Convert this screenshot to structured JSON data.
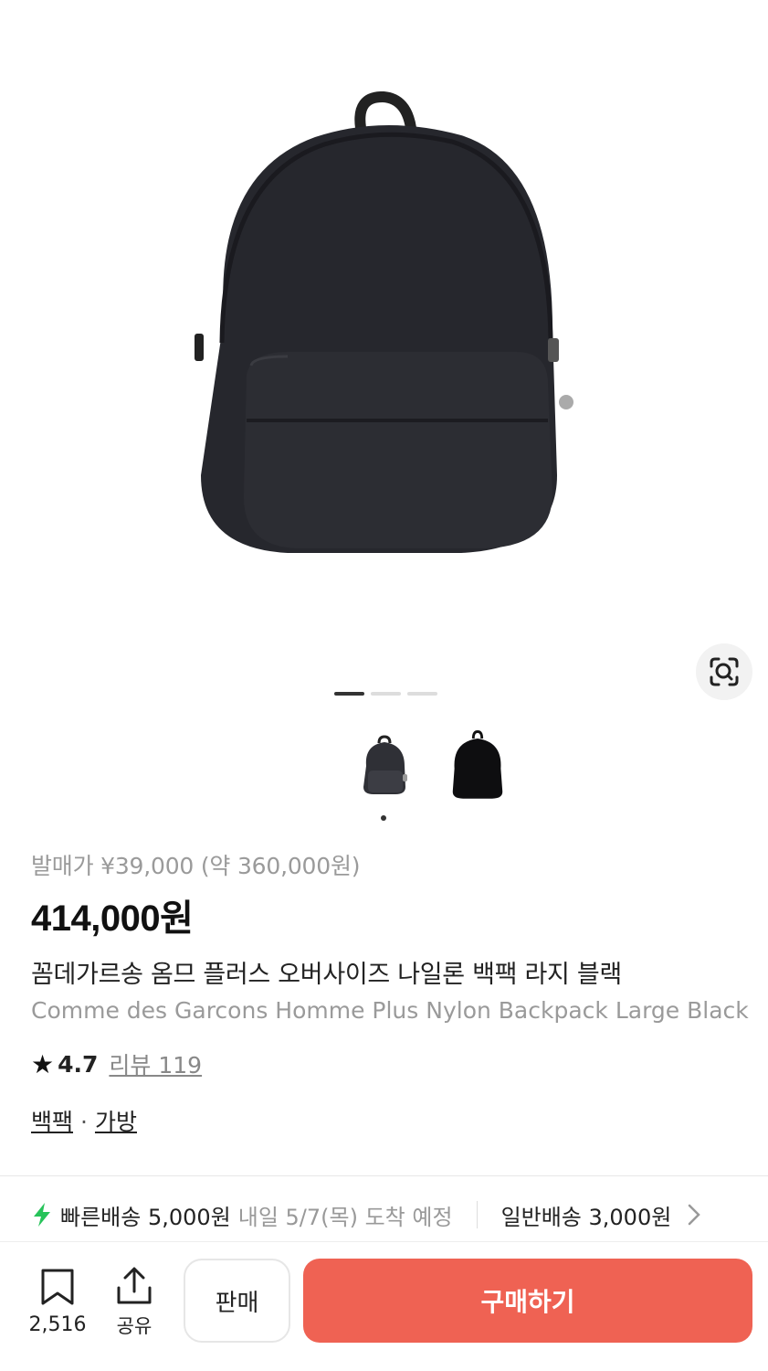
{
  "product": {
    "release_price": "발매가 ¥39,000 (약 360,000원)",
    "price": "414,000원",
    "title_ko": "꼼데가르송 옴므 플러스 오버사이즈 나일론 백팩 라지 블랙",
    "title_en": "Comme des Garcons Homme Plus Nylon Backpack Large Black",
    "rating": "4.7",
    "reviews": "리뷰 119",
    "categories": [
      "백팩",
      "가방"
    ],
    "category_sep": "·"
  },
  "gallery": {
    "page_count": 3,
    "active_page": 1,
    "thumbnails": [
      "backpack-side-thumbnail",
      "backpack-front-thumbnail"
    ]
  },
  "shipping": {
    "fast": "빠른배송 5,000원",
    "fast_date": "내일 5/7(목) 도착 예정",
    "normal": "일반배송 3,000원"
  },
  "bottom": {
    "bookmark_count": "2,516",
    "share_label": "공유",
    "sell_label": "판매",
    "buy_label": "구매하기"
  },
  "colors": {
    "buy_button": "#ef6253",
    "fast_shipping_icon": "#27c35a"
  },
  "icons": [
    "lens-search-icon",
    "star-icon",
    "lightning-icon",
    "chevron-right-icon",
    "bookmark-icon",
    "share-icon"
  ]
}
